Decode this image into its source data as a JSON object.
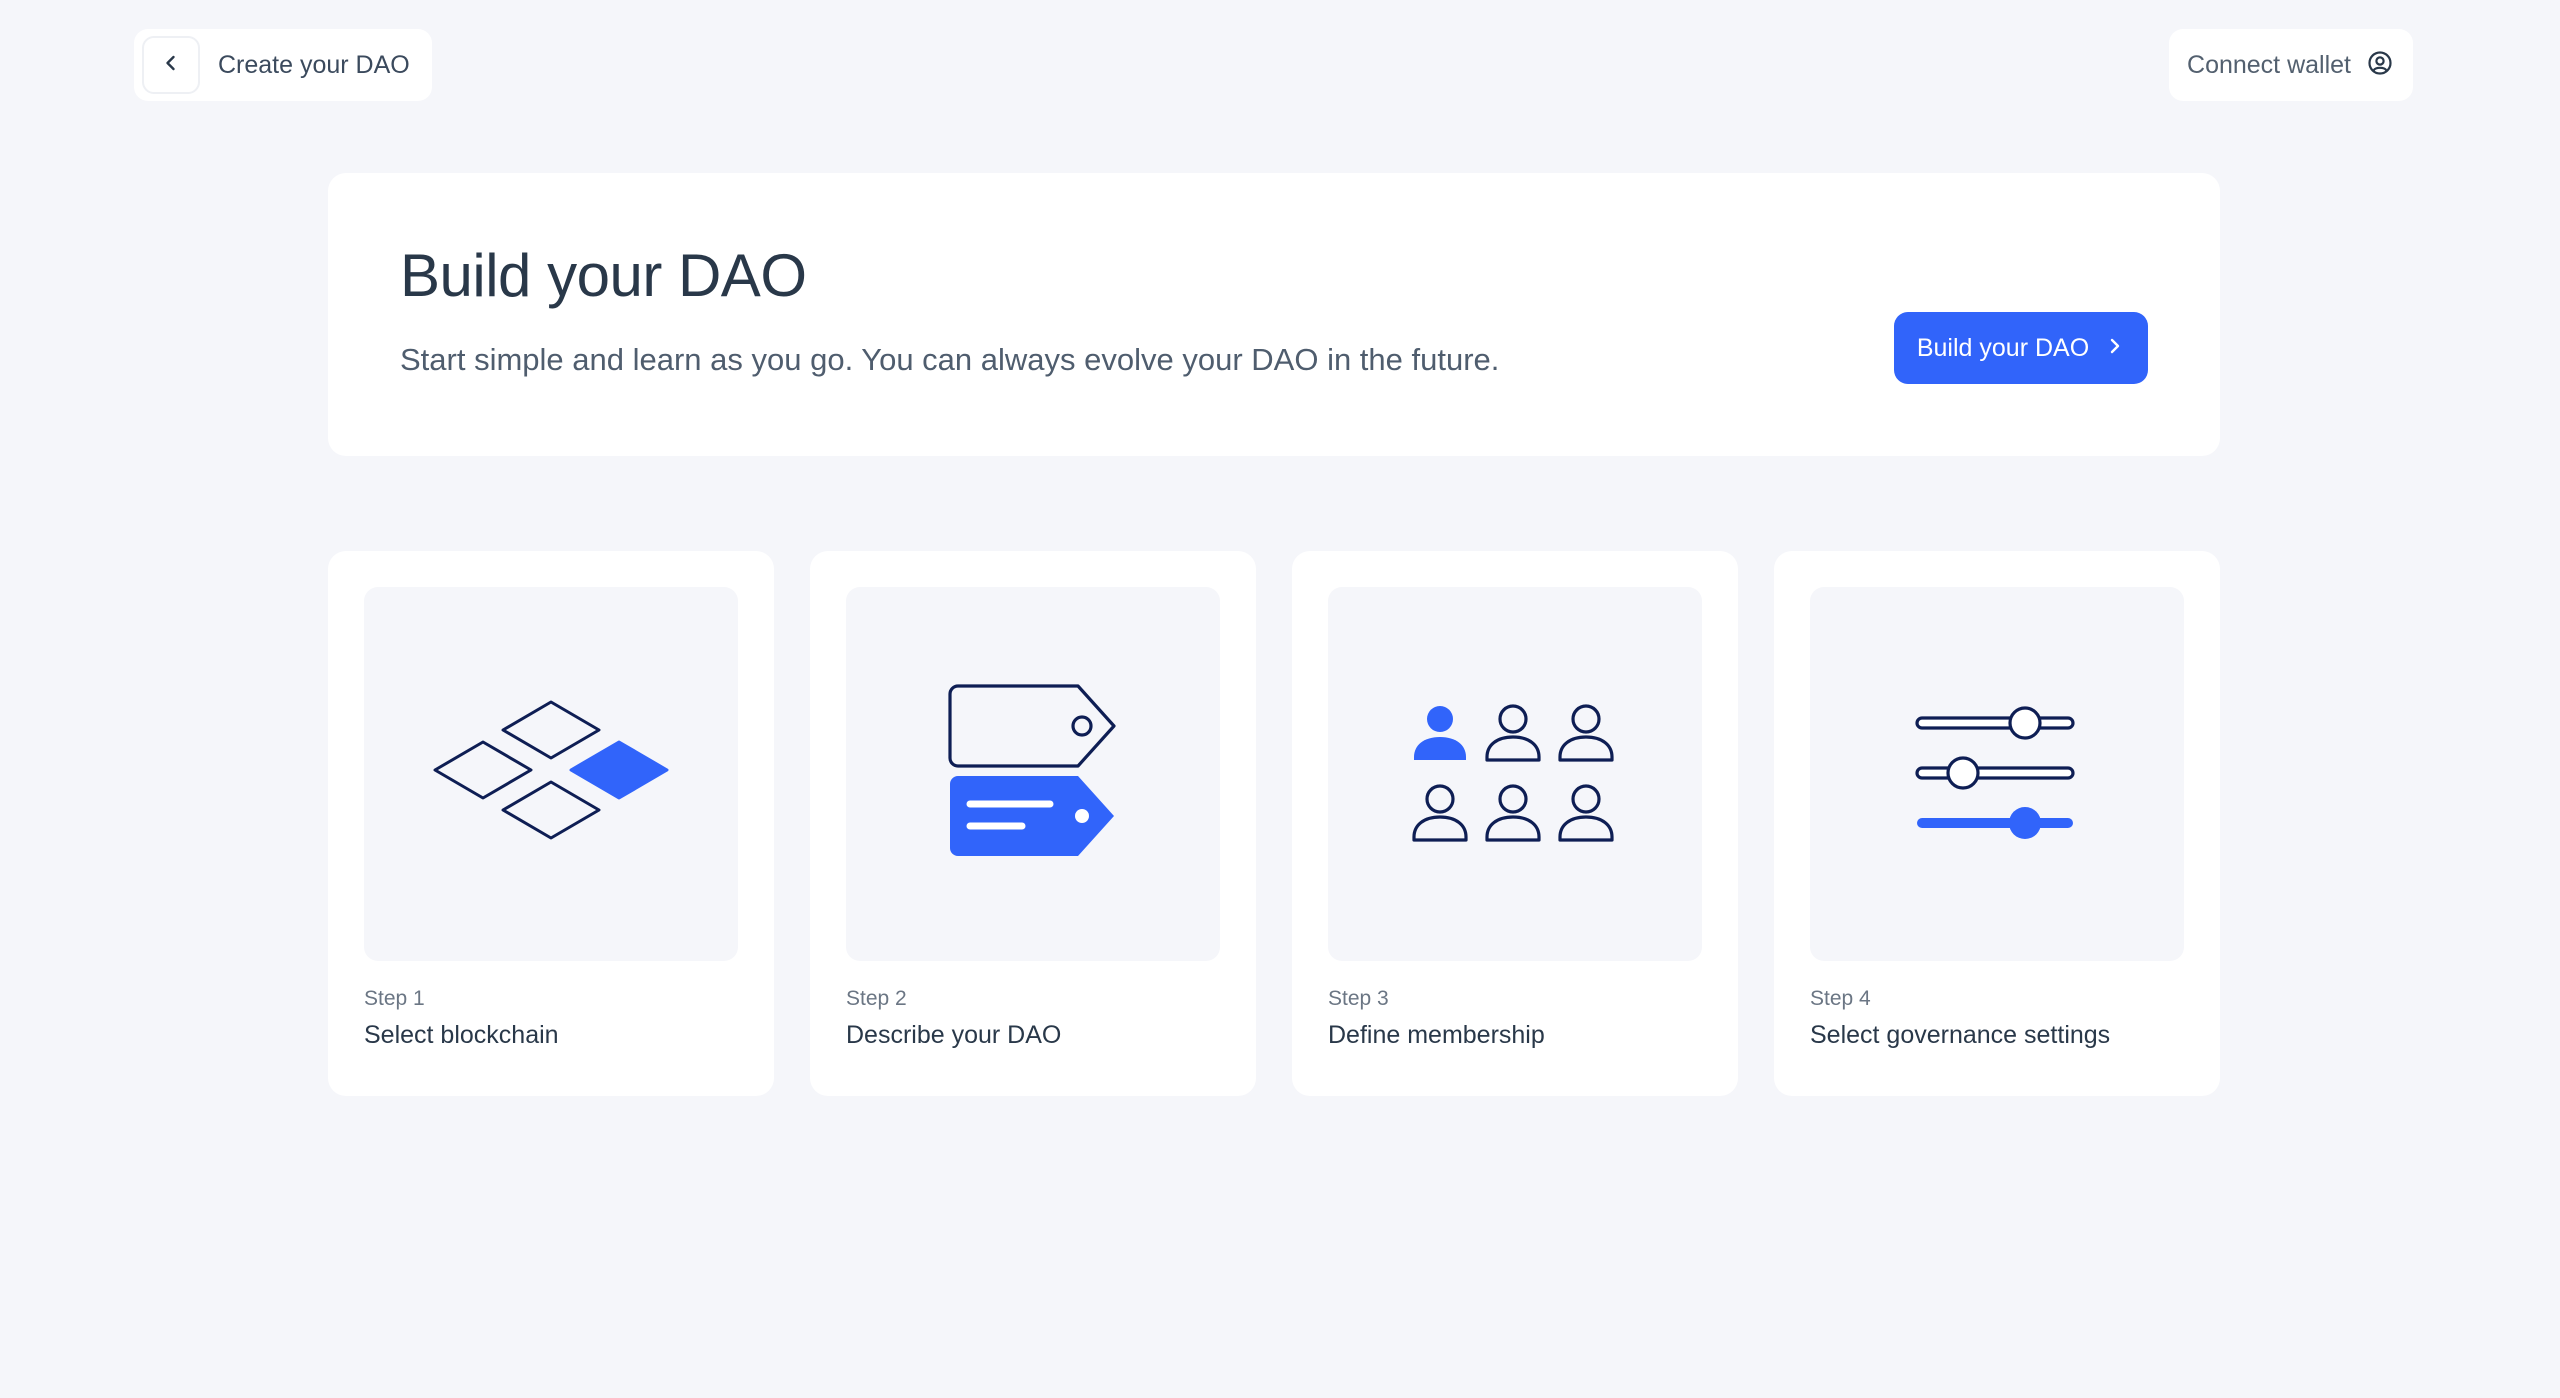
{
  "topbar": {
    "crumb_label": "Create your DAO",
    "wallet_label": "Connect wallet"
  },
  "hero": {
    "title": "Build your DAO",
    "subtitle": "Start simple and learn as you go. You can always evolve your DAO in the future.",
    "cta_label": "Build your DAO"
  },
  "steps": [
    {
      "number": "Step 1",
      "title": "Select blockchain",
      "icon": "blockchain-icon"
    },
    {
      "number": "Step 2",
      "title": "Describe your DAO",
      "icon": "tags-icon"
    },
    {
      "number": "Step 3",
      "title": "Define membership",
      "icon": "members-icon"
    },
    {
      "number": "Step 4",
      "title": "Select governance settings",
      "icon": "sliders-icon"
    }
  ],
  "colors": {
    "accent": "#3164fa",
    "ink": "#0e1e54",
    "background": "#f5f6fa",
    "text": "#293849"
  }
}
